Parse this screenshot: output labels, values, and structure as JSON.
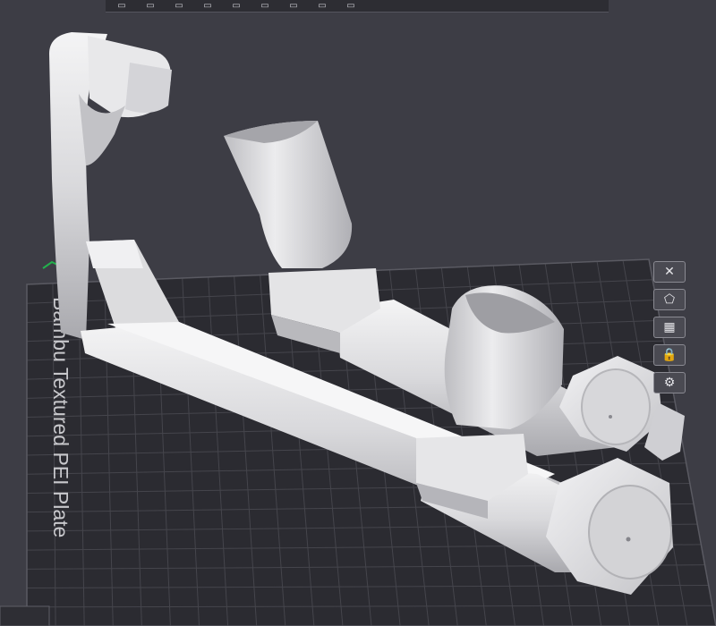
{
  "bed": {
    "plate_name": "Bambu Textured PEI Plate"
  },
  "toolbar": {
    "buttons": [
      {
        "icon": "add-object-icon"
      },
      {
        "icon": "arrange-icon"
      },
      {
        "icon": "layers-icon"
      },
      {
        "icon": "lay-on-face-icon"
      },
      {
        "icon": "move-icon"
      },
      {
        "icon": "orient-icon"
      },
      {
        "icon": "cut-icon"
      },
      {
        "icon": "support-paint-icon"
      },
      {
        "icon": "measure-icon"
      }
    ]
  },
  "plate_tools": [
    {
      "icon": "close-icon",
      "glyph": "✕"
    },
    {
      "icon": "auto-orient-icon",
      "glyph": "⬠"
    },
    {
      "icon": "arrange-plate-icon",
      "glyph": "▦"
    },
    {
      "icon": "lock-icon",
      "glyph": "🔒"
    },
    {
      "icon": "settings-icon",
      "glyph": "⚙"
    }
  ],
  "colors": {
    "background": "#3d3d45",
    "bed": "#2b2b31",
    "grid_line": "#45454c",
    "model": "#e2e2e4",
    "accent_green": "#22b14c"
  }
}
